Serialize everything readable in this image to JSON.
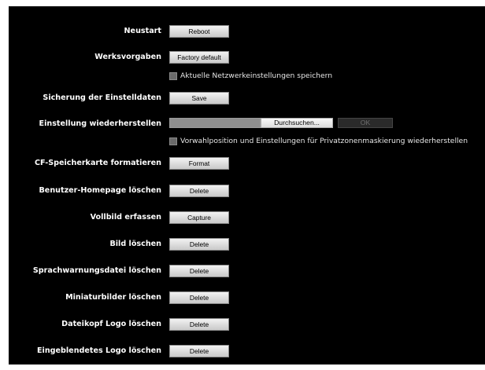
{
  "rows": {
    "reboot": {
      "label": "Neustart",
      "button": "Reboot"
    },
    "factory": {
      "label": "Werksvorgaben",
      "button": "Factory default",
      "checkbox_label": "Aktuelle Netzwerkeinstellungen speichern"
    },
    "backup": {
      "label": "Sicherung der Einstelldaten",
      "button": "Save"
    },
    "restore": {
      "label": "Einstellung wiederherstellen",
      "file_value": "",
      "browse_button": "Durchsuchen...",
      "ok_button": "OK",
      "checkbox_label": "Vorwahlposition und Einstellungen für Privatzonenmaskierung wiederherstellen"
    },
    "cf_format": {
      "label": "CF-Speicherkarte formatieren",
      "button": "Format"
    },
    "homepage_delete": {
      "label": "Benutzer-Homepage löschen",
      "button": "Delete"
    },
    "capture": {
      "label": "Vollbild erfassen",
      "button": "Capture"
    },
    "image_delete": {
      "label": "Bild löschen",
      "button": "Delete"
    },
    "voice_delete": {
      "label": "Sprachwarnungsdatei löschen",
      "button": "Delete"
    },
    "thumbs_delete": {
      "label": "Miniaturbilder löschen",
      "button": "Delete"
    },
    "header_logo_delete": {
      "label": "Dateikopf Logo löschen",
      "button": "Delete"
    },
    "overlay_logo_delete": {
      "label": "Eingeblendetes Logo löschen",
      "button": "Delete"
    }
  },
  "colors": {
    "panel_background": "#000000",
    "label_text": "#ffffff",
    "button_face": "#e0e0e0",
    "disabled_text": "#6f6f6f"
  }
}
